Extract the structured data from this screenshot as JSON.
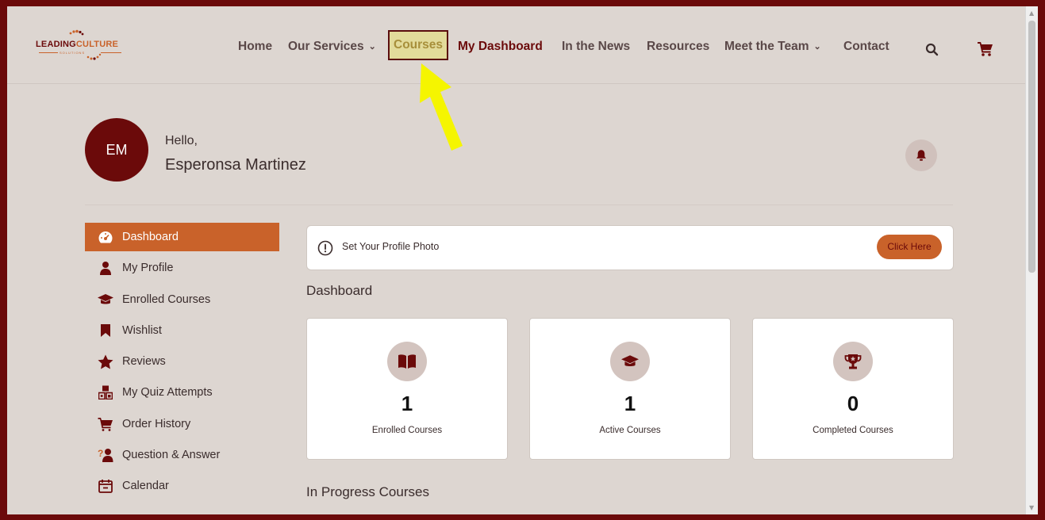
{
  "logo": {
    "lead": "LEADING",
    "culture": "CULTURE",
    "sub": "SOLUTIONS"
  },
  "nav": {
    "home": "Home",
    "services": "Our Services",
    "courses": "Courses",
    "dashboard": "My Dashboard",
    "news": "In the News",
    "resources": "Resources",
    "team": "Meet the Team",
    "contact": "Contact"
  },
  "profile": {
    "initials": "EM",
    "greeting": "Hello,",
    "name": "Esperonsa Martinez"
  },
  "sidebar": {
    "items": [
      {
        "label": "Dashboard",
        "icon": "dashboard-gauge-icon"
      },
      {
        "label": "My Profile",
        "icon": "user-icon"
      },
      {
        "label": "Enrolled Courses",
        "icon": "graduation-cap-icon"
      },
      {
        "label": "Wishlist",
        "icon": "bookmark-icon"
      },
      {
        "label": "Reviews",
        "icon": "star-icon"
      },
      {
        "label": "My Quiz Attempts",
        "icon": "cubes-icon"
      },
      {
        "label": "Order History",
        "icon": "cart-icon"
      },
      {
        "label": "Question & Answer",
        "icon": "question-person-icon"
      },
      {
        "label": "Calendar",
        "icon": "calendar-icon"
      }
    ]
  },
  "alert": {
    "text": "Set Your Profile Photo",
    "button": "Click Here"
  },
  "dashboard": {
    "title": "Dashboard",
    "stats": [
      {
        "value": "1",
        "label": "Enrolled Courses",
        "icon": "book-open-icon"
      },
      {
        "value": "1",
        "label": "Active Courses",
        "icon": "graduation-cap-icon"
      },
      {
        "value": "0",
        "label": "Completed Courses",
        "icon": "trophy-icon"
      }
    ],
    "in_progress_title": "In Progress Courses"
  },
  "colors": {
    "brand_dark": "#6b0a0a",
    "accent": "#c9622a",
    "page_bg": "#ddd6d1",
    "highlight": "#e2db9a",
    "arrow": "#f5f500"
  }
}
